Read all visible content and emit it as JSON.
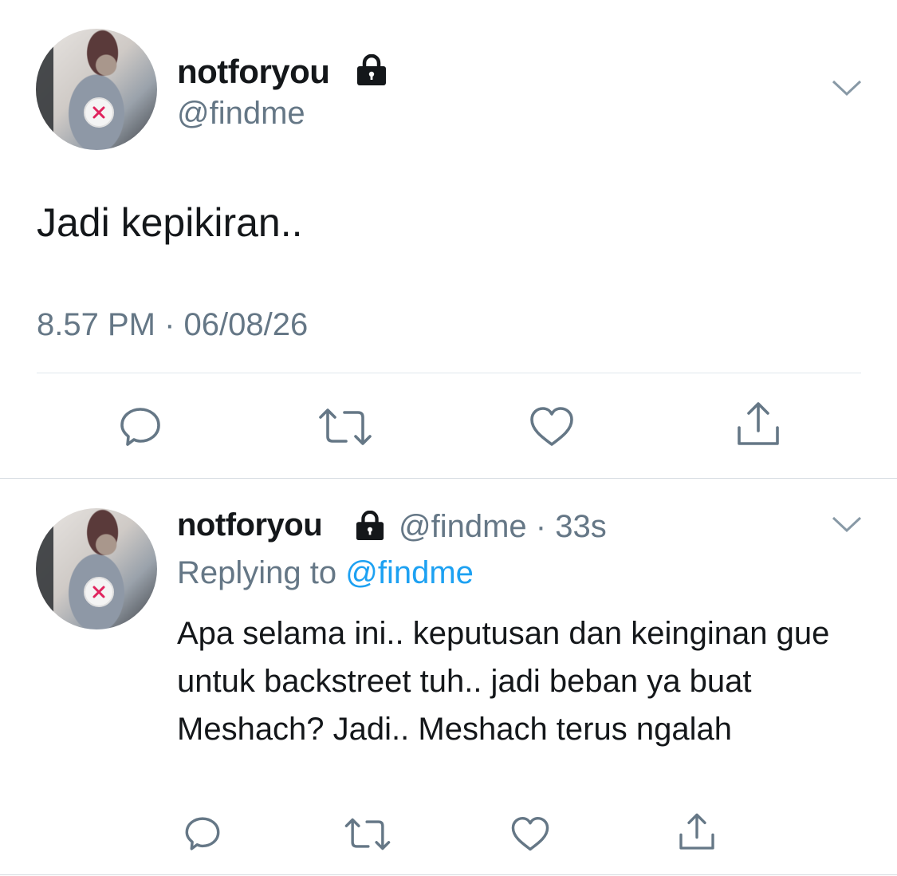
{
  "tweet_main": {
    "display_name": "notforyou",
    "handle": "@findme",
    "text": "Jadi kepikiran..",
    "timestamp": "8.57 PM · 06/08/26",
    "actions": [
      "reply-icon",
      "retweet-icon",
      "like-icon",
      "share-icon"
    ]
  },
  "tweet_reply": {
    "display_name": "notforyou",
    "handle": "@findme",
    "separator": "·",
    "age": "33s",
    "replying_prefix": "Replying to",
    "replying_to": "@findme",
    "text": "Apa selama ini.. keputusan dan keinginan gue untuk backstreet tuh.. jadi beban ya buat Meshach? Jadi.. Meshach terus ngalah",
    "actions": [
      "reply-icon",
      "retweet-icon",
      "like-icon",
      "share-icon"
    ]
  },
  "colors": {
    "text_primary": "#14171a",
    "text_secondary": "#657786",
    "link": "#1da1f2",
    "divider": "#e1e8ed"
  }
}
